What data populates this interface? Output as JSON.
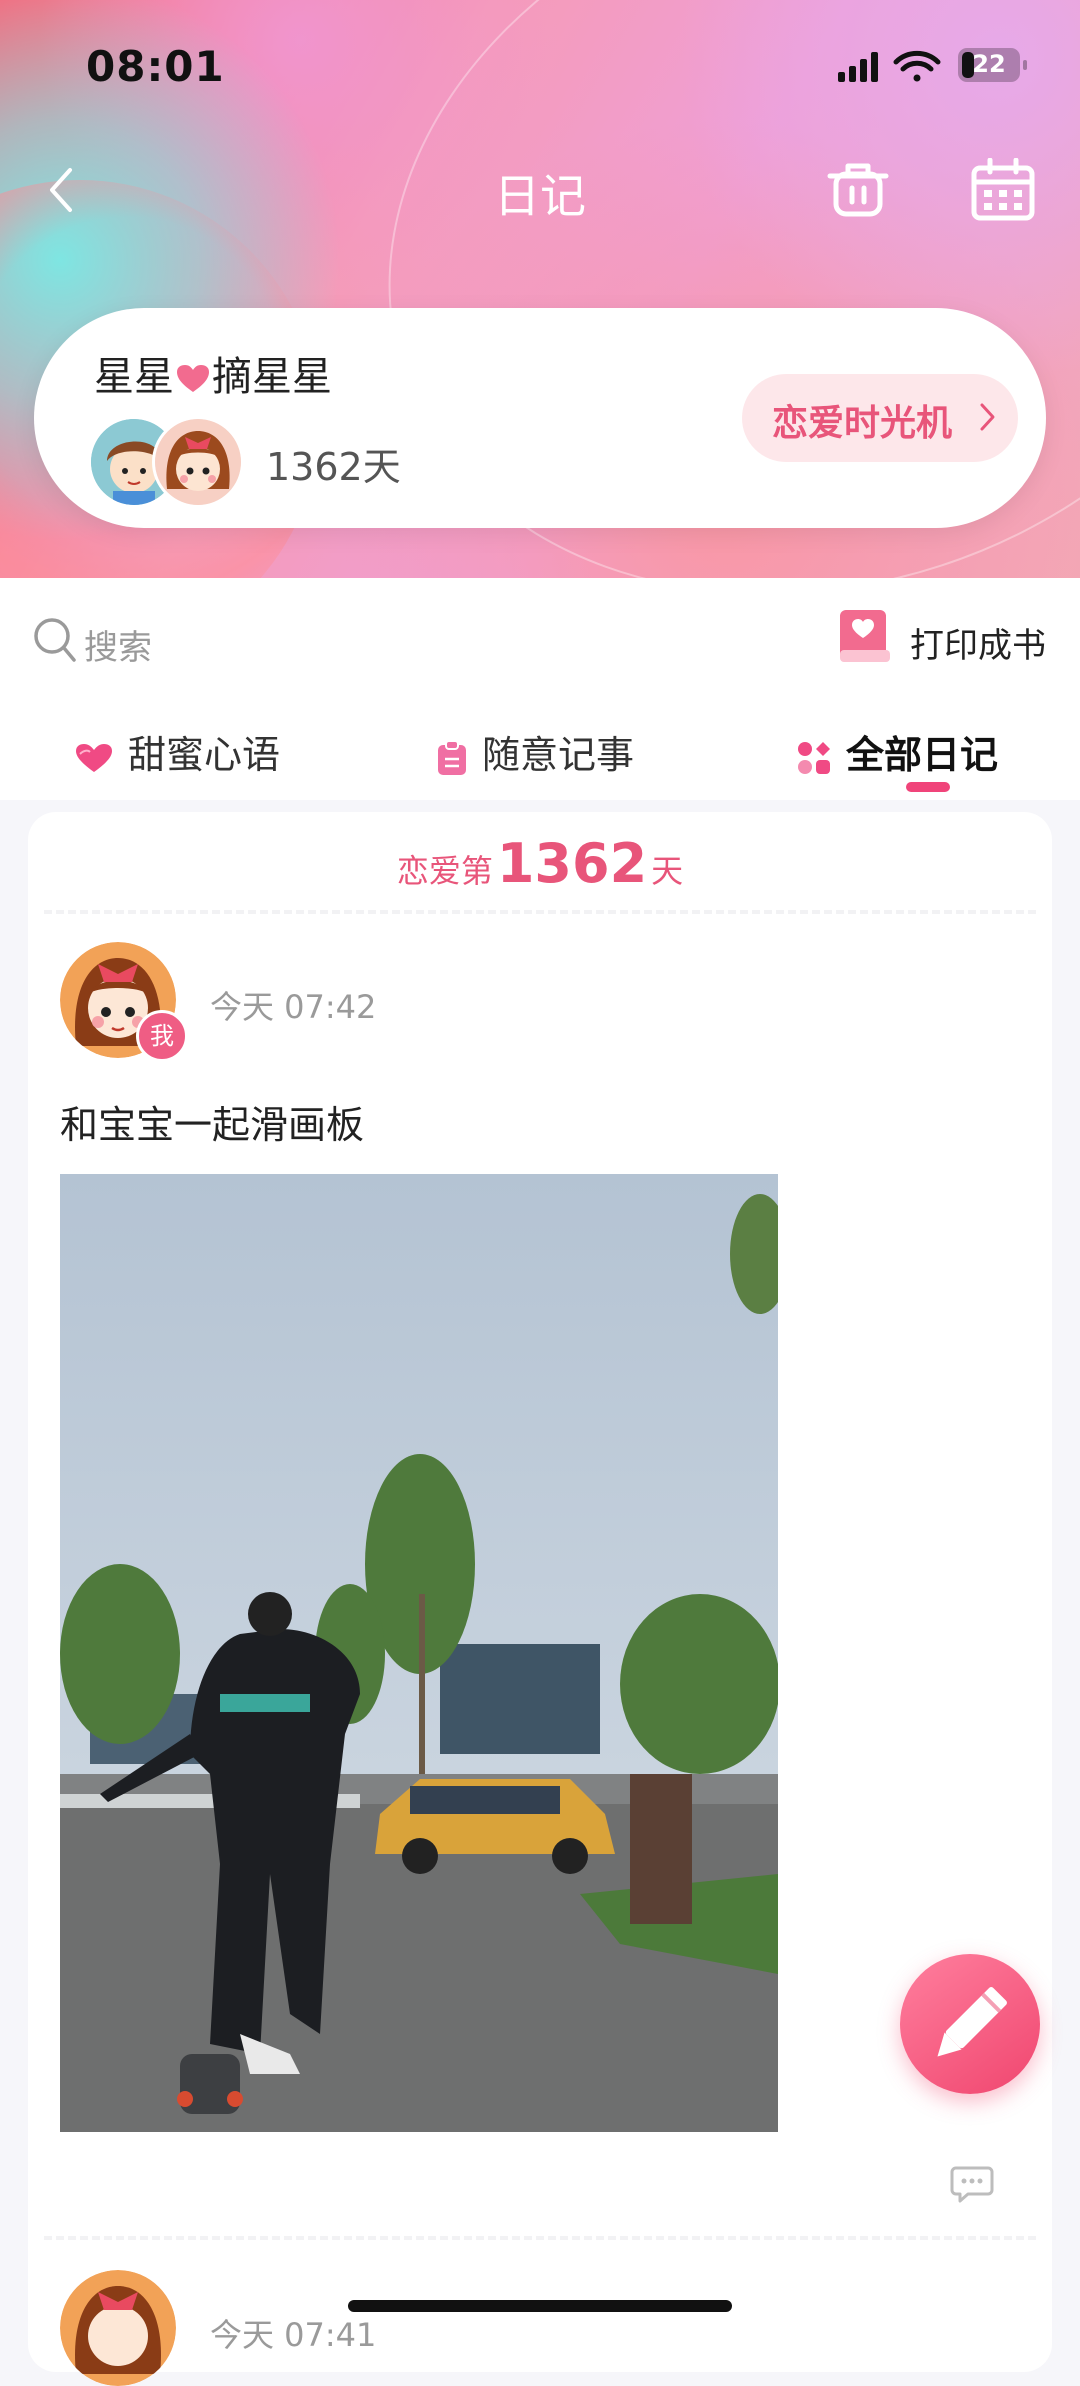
{
  "status_bar": {
    "time": "08:01",
    "battery": "22"
  },
  "nav": {
    "title": "日记"
  },
  "couple_card": {
    "name_left": "星星",
    "name_right": "摘星星",
    "days": "1362天",
    "time_machine": "恋爱时光机"
  },
  "search": {
    "placeholder": "搜索"
  },
  "print_book": {
    "label": "打印成书"
  },
  "tabs": [
    {
      "label": "甜蜜心语",
      "icon": "heart-icon"
    },
    {
      "label": "随意记事",
      "icon": "note-icon"
    },
    {
      "label": "全部日记",
      "icon": "grid-icon",
      "active": true
    }
  ],
  "feed": {
    "love_day_prefix": "恋爱第",
    "love_day_count": "1362",
    "love_day_suffix": "天",
    "entries": [
      {
        "author_badge": "我",
        "time": "今天 07:42",
        "text": "和宝宝一起滑画板"
      },
      {
        "time": "今天 07:41"
      }
    ]
  },
  "colors": {
    "accent": "#e8557a",
    "active_tab_underline": "#f0447a",
    "fab": "#f0466f"
  }
}
